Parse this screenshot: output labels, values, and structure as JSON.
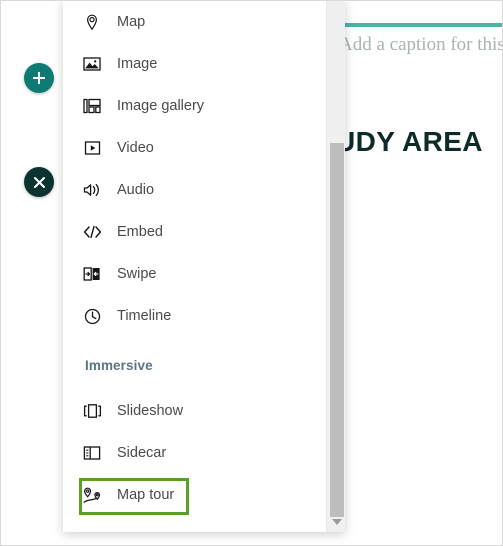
{
  "canvas": {
    "caption_placeholder": "Add a caption for this",
    "title_fragment": "UDY AREA",
    "accent_color": "#4cb3ab",
    "title_color": "#0d2b28"
  },
  "actions": {
    "add_button": {
      "icon": "plus-icon",
      "color": "#0d7b73",
      "label": ""
    },
    "close_button": {
      "icon": "close-icon",
      "color": "#0d3330",
      "label": ""
    }
  },
  "picker": {
    "basic_blocks": [
      {
        "label": "Map",
        "icon": "map-pin-icon"
      },
      {
        "label": "Image",
        "icon": "image-icon"
      },
      {
        "label": "Image gallery",
        "icon": "image-gallery-icon"
      },
      {
        "label": "Video",
        "icon": "video-icon"
      },
      {
        "label": "Audio",
        "icon": "audio-icon"
      },
      {
        "label": "Embed",
        "icon": "embed-code-icon"
      },
      {
        "label": "Swipe",
        "icon": "swipe-icon"
      },
      {
        "label": "Timeline",
        "icon": "timeline-clock-icon"
      }
    ],
    "immersive_heading": "Immersive",
    "immersive_blocks": [
      {
        "label": "Slideshow",
        "icon": "slideshow-icon"
      },
      {
        "label": "Sidecar",
        "icon": "sidecar-icon"
      },
      {
        "label": "Map tour",
        "icon": "map-tour-icon"
      }
    ],
    "highlighted_item": "Map tour",
    "highlight_color": "#5ba026"
  },
  "scrollbar": {
    "down_arrow_icon": "chevron-down-icon"
  }
}
